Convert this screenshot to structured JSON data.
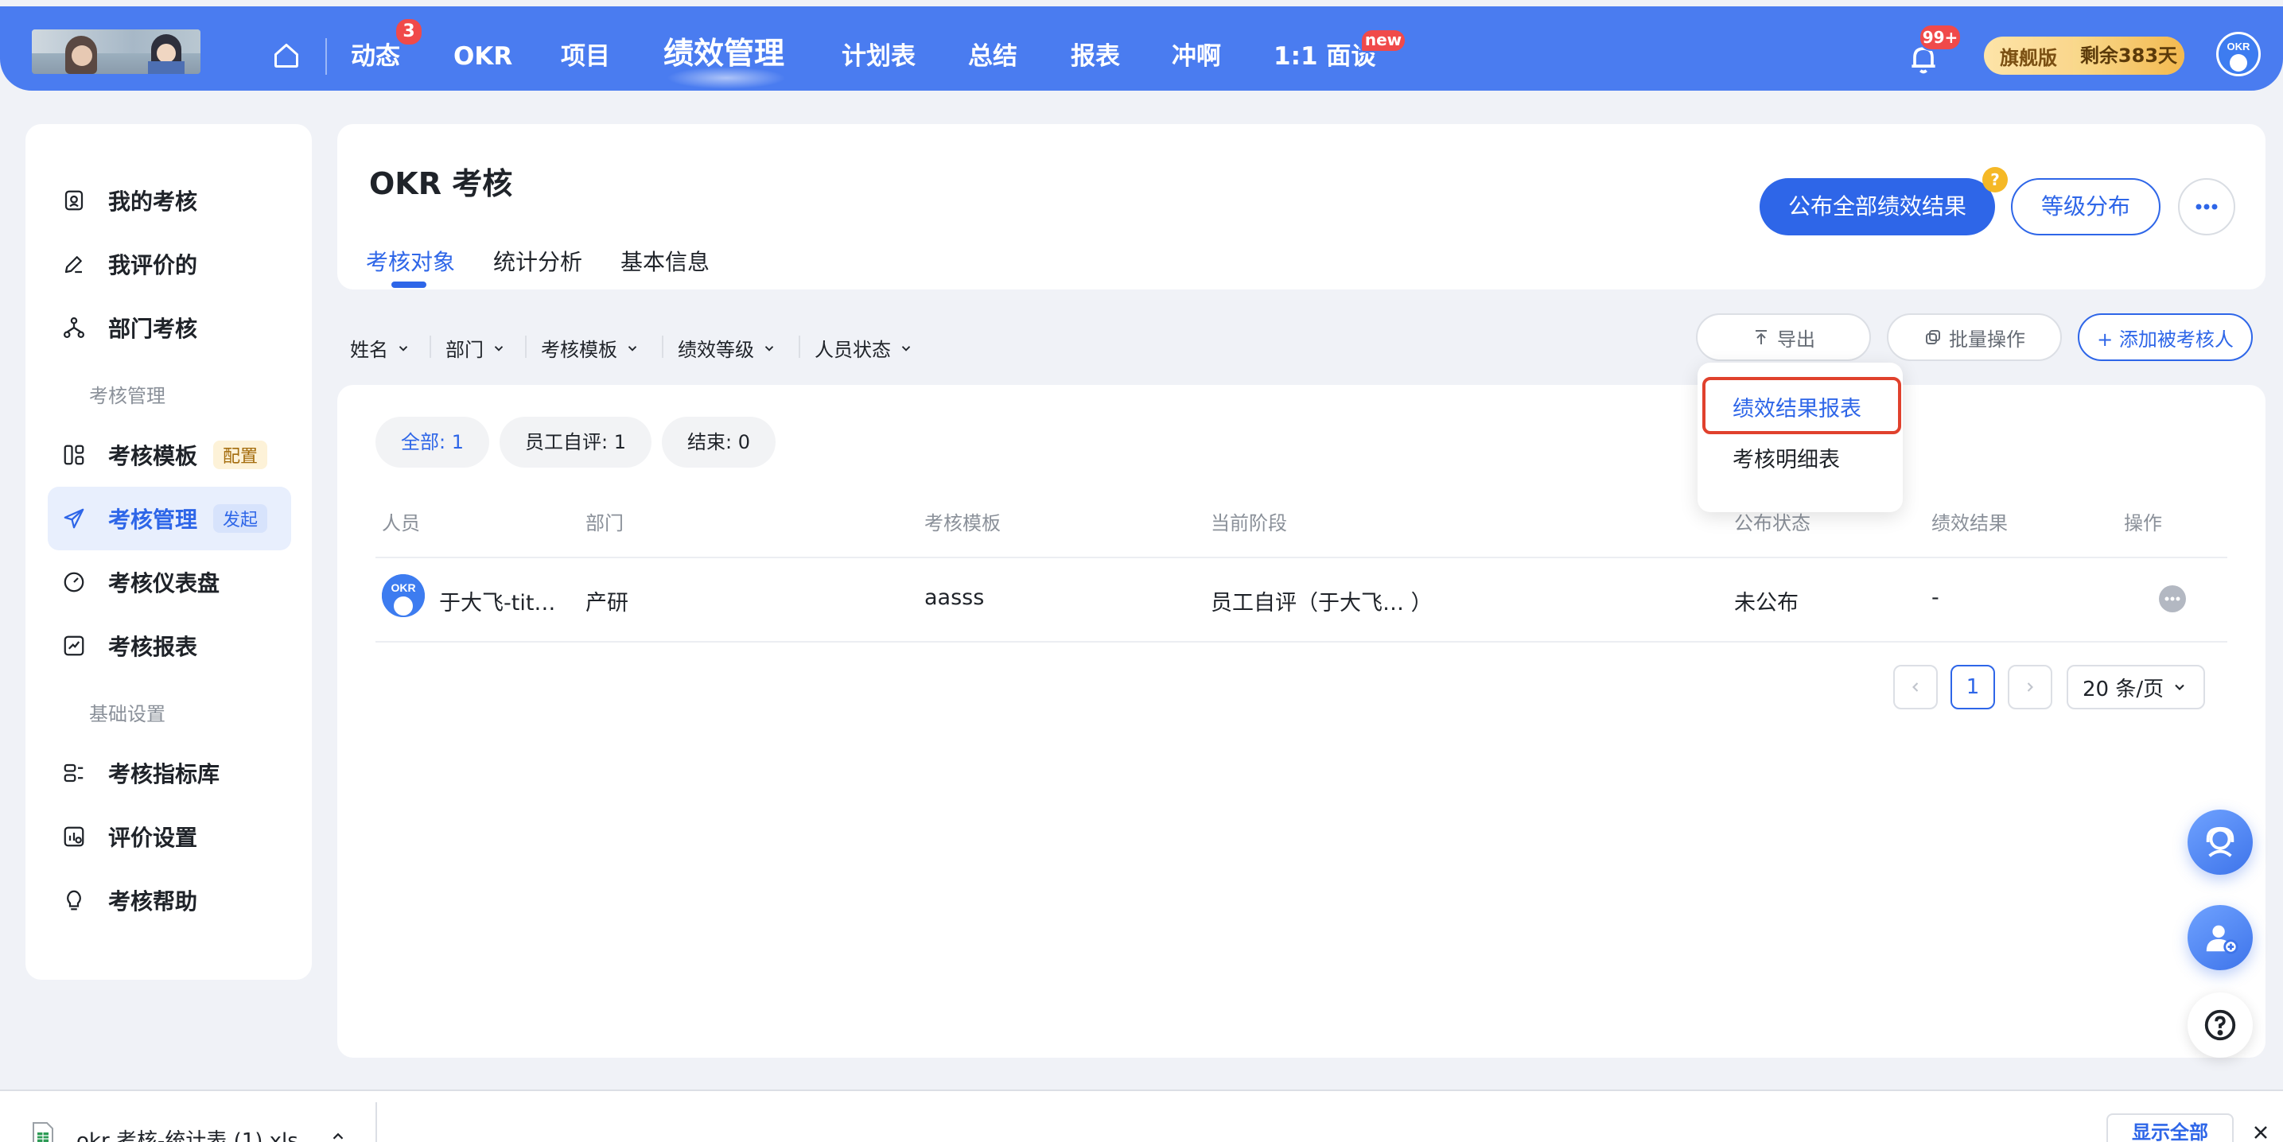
{
  "nav": {
    "items": [
      {
        "label": "动态",
        "badge": "3"
      },
      {
        "label": "OKR"
      },
      {
        "label": "项目"
      },
      {
        "label": "绩效管理",
        "active": true
      },
      {
        "label": "计划表"
      },
      {
        "label": "总结"
      },
      {
        "label": "报表"
      },
      {
        "label": "冲啊"
      },
      {
        "label": "1:1 面谈",
        "badge": "new"
      }
    ],
    "notification_count": "99+",
    "tier": "旗舰版",
    "days_left": "剩余383天",
    "avatar_text": "OKR",
    "colors": {
      "nav_bg": "#4a7cf0",
      "accent": "#2e66e8",
      "badge": "#f04a4a"
    }
  },
  "sidebar": {
    "items": [
      {
        "label": "我的考核",
        "icon": "user-file-icon"
      },
      {
        "label": "我评价的",
        "icon": "pen-icon"
      },
      {
        "label": "部门考核",
        "icon": "org-chart-icon"
      },
      {
        "group": "考核管理"
      },
      {
        "label": "考核模板",
        "icon": "template-icon",
        "tag": "配置"
      },
      {
        "label": "考核管理",
        "icon": "send-icon",
        "tag": "发起",
        "active": true
      },
      {
        "label": "考核仪表盘",
        "icon": "gauge-icon"
      },
      {
        "label": "考核报表",
        "icon": "chart-icon"
      },
      {
        "group": "基础设置"
      },
      {
        "label": "考核指标库",
        "icon": "list-icon"
      },
      {
        "label": "评价设置",
        "icon": "settings-chart-icon"
      },
      {
        "label": "考核帮助",
        "icon": "lightbulb-icon"
      }
    ]
  },
  "header": {
    "title": "OKR 考核",
    "tabs": [
      "考核对象",
      "统计分析",
      "基本信息"
    ],
    "publish_all": "公布全部绩效结果",
    "help_mark": "?",
    "grade_distribution": "等级分布"
  },
  "filters": [
    "姓名",
    "部门",
    "考核模板",
    "绩效等级",
    "人员状态"
  ],
  "toolbar": {
    "export": "导出",
    "batch": "批量操作",
    "add": "+ 添加被考核人"
  },
  "export_menu": [
    "绩效结果报表",
    "考核明细表"
  ],
  "chips": [
    "全部: 1",
    "员工自评: 1",
    "结束: 0"
  ],
  "table": {
    "columns": [
      "人员",
      "部门",
      "考核模板",
      "当前阶段",
      "公布状态",
      "绩效结果",
      "操作"
    ],
    "rows": [
      {
        "person": "于大飞-tit…",
        "dept": "产研",
        "template": "aasss",
        "stage": "员工自评（于大飞… ）",
        "publish": "未公布",
        "result": "-"
      }
    ]
  },
  "pagination": {
    "current": "1",
    "page_size": "20 条/页"
  },
  "download_bar": {
    "file": "okr 考核-统计表 (1).xls",
    "show_all": "显示全部"
  }
}
